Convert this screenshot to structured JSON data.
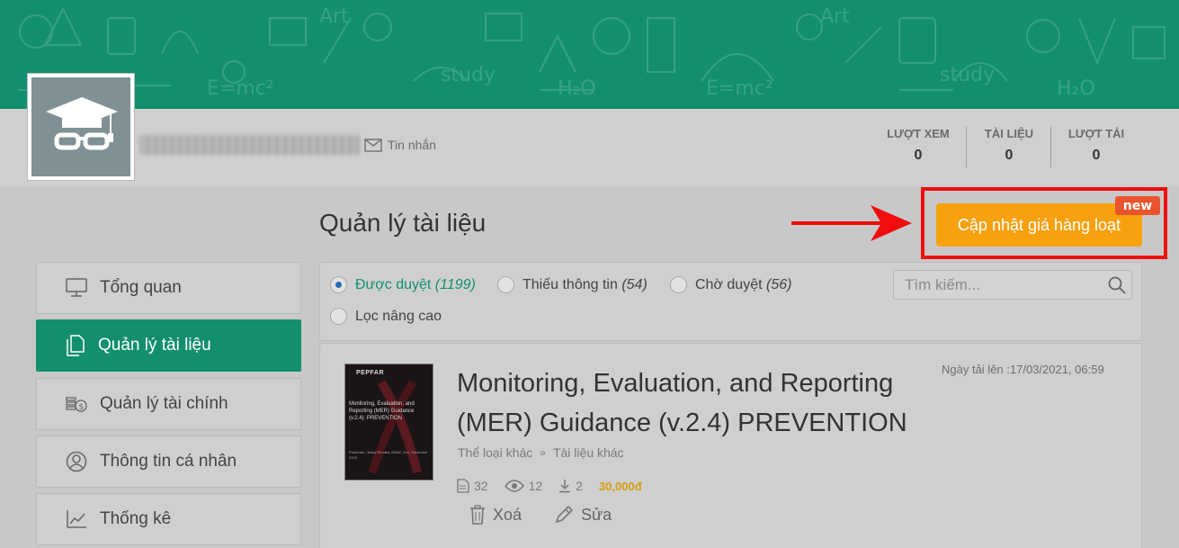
{
  "profile": {
    "message_label": "Tin nhắn"
  },
  "stats": [
    {
      "label": "LƯỢT XEM",
      "value": "0"
    },
    {
      "label": "TÀI LIỆU",
      "value": "0"
    },
    {
      "label": "LƯỢT TẢI",
      "value": "0"
    }
  ],
  "page_title": "Quản lý tài liệu",
  "cta": {
    "label": "Cập nhật giá hàng loạt",
    "badge": "new"
  },
  "sidebar": {
    "items": [
      {
        "label": "Tổng quan",
        "icon": "monitor-icon",
        "active": false
      },
      {
        "label": "Quản lý tài liệu",
        "icon": "documents-icon",
        "active": true
      },
      {
        "label": "Quản lý tài chính",
        "icon": "coins-icon",
        "active": false
      },
      {
        "label": "Thông tin cá nhân",
        "icon": "user-icon",
        "active": false
      },
      {
        "label": "Thống kê",
        "icon": "chart-icon",
        "active": false
      }
    ]
  },
  "filters": {
    "approved": {
      "label": "Được duyệt",
      "count": "(1199)",
      "selected": true
    },
    "missing": {
      "label": "Thiếu thông tin",
      "count": "(54)",
      "selected": false
    },
    "pending": {
      "label": "Chờ duyệt",
      "count": "(56)",
      "selected": false
    },
    "advanced": {
      "label": "Lọc nâng cao",
      "selected": false
    },
    "search_placeholder": "Tìm kiếm..."
  },
  "document": {
    "title": "Monitoring, Evaluation, and Reporting (MER) Guidance (v.2.4) PREVENTION",
    "upload_date": "Ngày tải lên :17/03/2021, 06:59",
    "category": "Thể loại khác",
    "subcategory": "Tài liệu khác",
    "pages": "32",
    "views": "12",
    "downloads": "2",
    "price": "30,000đ",
    "delete_label": "Xoá",
    "edit_label": "Sửa",
    "thumbnail": {
      "logo": "PEPFAR",
      "title": "Monitoring, Evaluation, and Reporting (MER) Guidance (v.2.4): PREVENTION",
      "sub": "Presenter: Jenny Rhodes, MSAC 2nd, December 2019"
    }
  },
  "colors": {
    "brand_green": "#138f6e",
    "cta_orange": "#f7a10e",
    "highlight_red": "#f10d0d",
    "price_gold": "#d5a00e"
  }
}
